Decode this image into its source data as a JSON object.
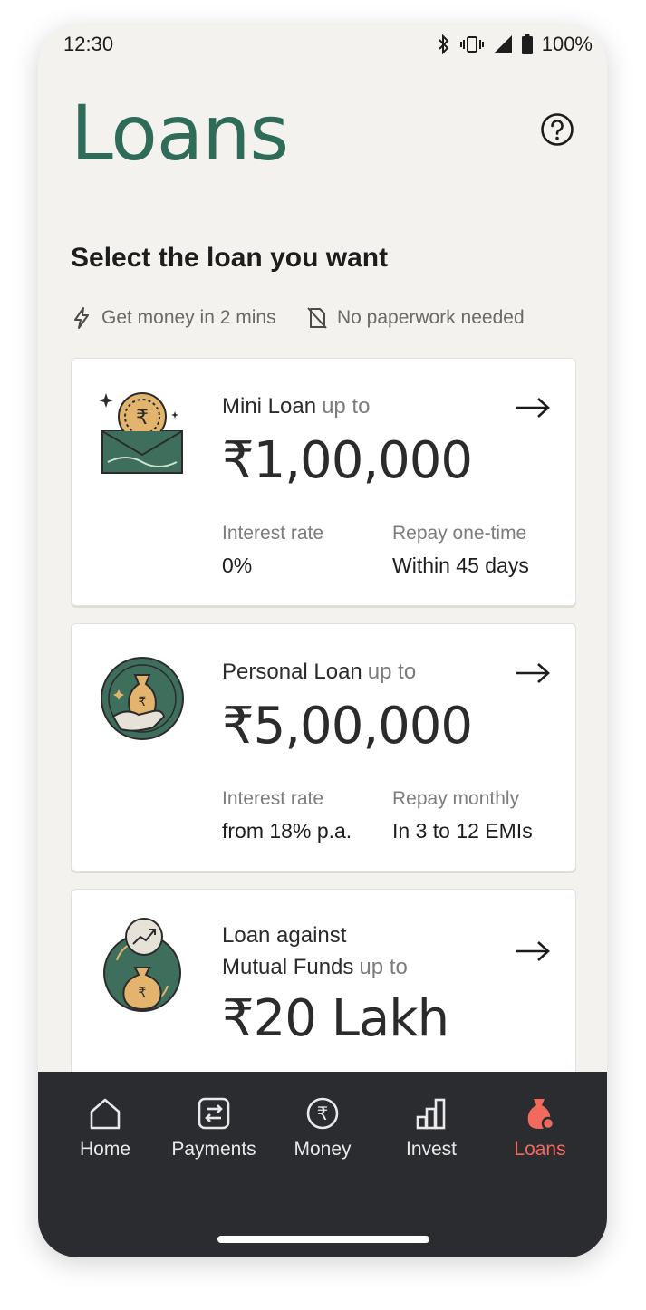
{
  "status_bar": {
    "time": "12:30",
    "battery": "100%"
  },
  "header": {
    "title": "Loans"
  },
  "section": {
    "title": "Select the loan you want",
    "features": [
      "Get money in 2 mins",
      "No paperwork needed"
    ]
  },
  "loans": [
    {
      "name": "Mini Loan",
      "upto": "up to",
      "amount": "₹1,00,000",
      "rate_label": "Interest rate",
      "rate_value": "0%",
      "repay_label": "Repay one-time",
      "repay_value": "Within 45 days"
    },
    {
      "name": "Personal Loan",
      "upto": "up to",
      "amount": "₹5,00,000",
      "rate_label": "Interest rate",
      "rate_value": "from 18% p.a.",
      "repay_label": "Repay monthly",
      "repay_value": "In 3 to 12 EMIs"
    },
    {
      "name_line1": "Loan against",
      "name_line2": "Mutual Funds",
      "upto": "up to",
      "amount": "₹20 Lakh"
    }
  ],
  "bottom_nav": {
    "items": [
      {
        "label": "Home",
        "icon": "home-icon"
      },
      {
        "label": "Payments",
        "icon": "transfer-icon"
      },
      {
        "label": "Money",
        "icon": "rupee-icon"
      },
      {
        "label": "Invest",
        "icon": "bar-chart-icon"
      },
      {
        "label": "Loans",
        "icon": "money-bag-icon"
      }
    ],
    "active": "Loans"
  },
  "colors": {
    "brand_green": "#2f6b59",
    "active_nav": "#f26a5e",
    "nav_bg": "#2b2c30",
    "page_bg": "#f3f2ee"
  }
}
